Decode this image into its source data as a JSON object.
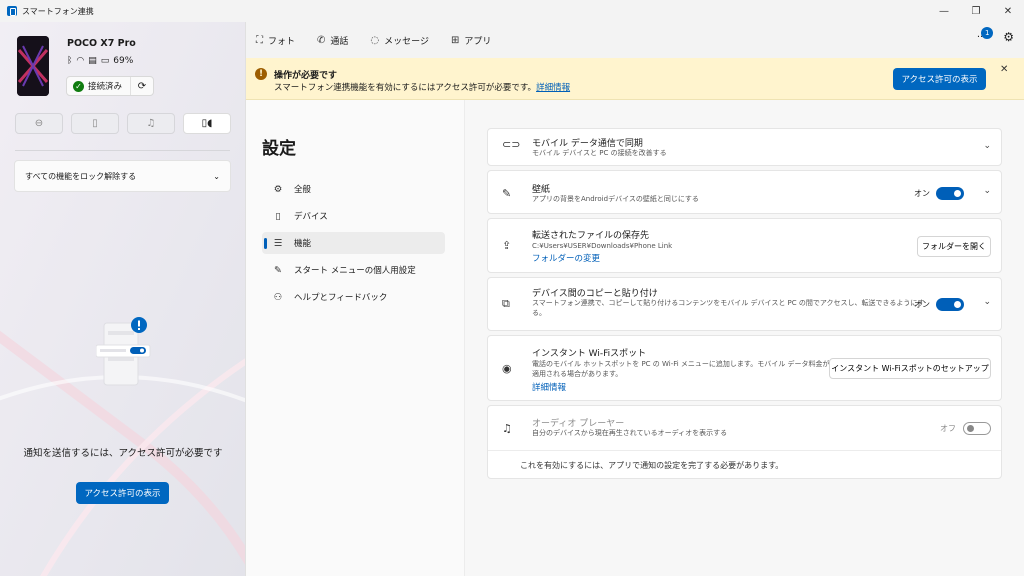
{
  "window": {
    "title": "スマートフォン連携",
    "minimize": "—",
    "maximize": "❐",
    "close": "✕"
  },
  "device": {
    "name": "POCO X7 Pro",
    "battery": "69%",
    "connected_label": "接続済み"
  },
  "left": {
    "lock_label": "すべての機能をロック解除する",
    "notify_text": "通知を送信するには、アクセス許可が必要です",
    "notify_button": "アクセス許可の表示"
  },
  "nav": {
    "photos": "フォト",
    "calls": "通話",
    "messages": "メッセージ",
    "apps": "アプリ",
    "badge": "1"
  },
  "banner": {
    "title": "操作が必要です",
    "body": "スマートフォン連携機能を有効にするにはアクセス許可が必要です。",
    "link": "詳細情報",
    "button": "アクセス許可の表示"
  },
  "settings": {
    "title": "設定",
    "nav": [
      "全般",
      "デバイス",
      "機能",
      "スタート メニューの個人用設定",
      "ヘルプとフィードバック"
    ],
    "cards": {
      "mobile_sync": {
        "title": "モバイル データ通信で同期",
        "desc": "モバイル デバイスと PC の接続を改善する"
      },
      "wallpaper": {
        "title": "壁紙",
        "desc": "アプリの背景をAndroidデバイスの壁紙と同じにする",
        "state": "オン"
      },
      "files": {
        "title": "転送されたファイルの保存先",
        "path": "C:¥Users¥USER¥Downloads¥Phone Link",
        "link": "フォルダーの変更",
        "button": "フォルダーを開く"
      },
      "clipboard": {
        "title": "デバイス間のコピーと貼り付け",
        "desc1": "スマートフォン連携で、コピーして貼り付けるコンテンツをモバイル デバイスと PC の間でアクセスし、転送できるようにす",
        "desc2": "る。",
        "state": "オン"
      },
      "hotspot": {
        "title": "インスタント Wi-Fiスポット",
        "desc1": "電話のモバイル ホットスポットを PC の Wi-Fi メニューに追加します。モバイル データ料金が",
        "desc2": "適用される場合があります。",
        "link": "詳細情報",
        "button": "インスタント Wi-Fiスポットのセットアップ"
      },
      "audio": {
        "title": "オーディオ プレーヤー",
        "desc": "自分のデバイスから現在再生されているオーディオを表示する",
        "state": "オフ",
        "note": "これを有効にするには、アプリで通知の設定を完了する必要があります。"
      }
    }
  },
  "colors": {
    "accent": "#0067c0",
    "banner_bg": "#fff4ce",
    "toggle_on": "#005fb8"
  }
}
